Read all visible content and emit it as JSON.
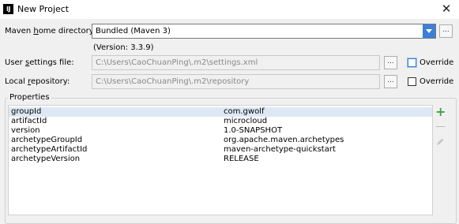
{
  "window": {
    "title": "New Project",
    "app_icon_text": "IJ",
    "close_glyph": "✕"
  },
  "maven_home": {
    "label_before": "Maven ",
    "label_mnemonic": "h",
    "label_after": "ome directory:",
    "selected_value": "Bundled (Maven 3)",
    "version_note": "(Version: 3.3.9)",
    "browse_label": "..."
  },
  "user_settings": {
    "label_before": "User ",
    "label_mnemonic": "s",
    "label_after": "ettings file:",
    "value": "C:\\Users\\CaoChuanPing\\.m2\\settings.xml",
    "browse_label": "...",
    "override_label": "Override",
    "override_checked": false
  },
  "local_repository": {
    "label_before": "Local ",
    "label_mnemonic": "r",
    "label_after": "epository:",
    "value": "C:\\Users\\CaoChuanPing\\.m2\\repository",
    "browse_label": "...",
    "override_label": "Override",
    "override_checked": false
  },
  "properties": {
    "group_title": "Properties",
    "add_icon": "add-icon",
    "remove_icon": "remove-icon",
    "edit_icon": "edit-icon",
    "accent_add": "#3fa43f",
    "selection_color": "#dde8f7",
    "rows": [
      {
        "key": "groupId",
        "value": " com.gwolf"
      },
      {
        "key": "artifactId",
        "value": "microcloud"
      },
      {
        "key": "version",
        "value": "1.0-SNAPSHOT"
      },
      {
        "key": "archetypeGroupId",
        "value": "org.apache.maven.archetypes"
      },
      {
        "key": "archetypeArtifactId",
        "value": "maven-archetype-quickstart"
      },
      {
        "key": "archetypeVersion",
        "value": "RELEASE"
      }
    ]
  }
}
